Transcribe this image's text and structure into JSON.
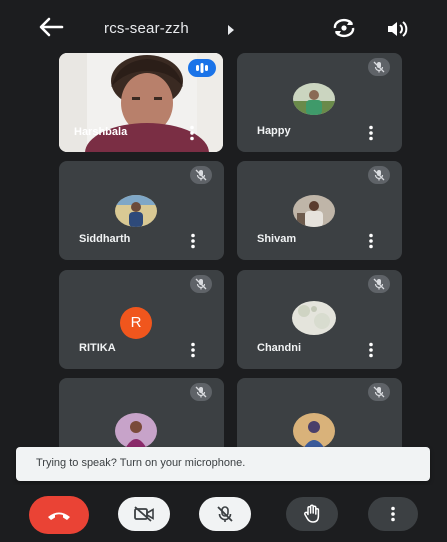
{
  "meeting": {
    "title": "rcs-sear-zzh"
  },
  "participants": [
    {
      "name": "Harshbala"
    },
    {
      "name": "Happy"
    },
    {
      "name": "Siddharth"
    },
    {
      "name": "Shivam"
    },
    {
      "name": "RITIKA",
      "initial": "R"
    },
    {
      "name": "Chandni"
    },
    {
      "name": ""
    },
    {
      "name": ""
    }
  ],
  "snackbar": {
    "text": "Trying to speak? Turn on your microphone."
  },
  "controls": {
    "end_call": "phone-hangup-icon",
    "camera": "camera-off-icon",
    "microphone": "mic-off-icon",
    "raise_hand": "hand-icon",
    "more": "more-vert-icon"
  },
  "colors": {
    "background": "#1c1d1f",
    "tile": "#3c4043",
    "end_call": "#ea4335",
    "letter_avatar": "#f0561d",
    "active_speaker": "#1a73e8"
  }
}
